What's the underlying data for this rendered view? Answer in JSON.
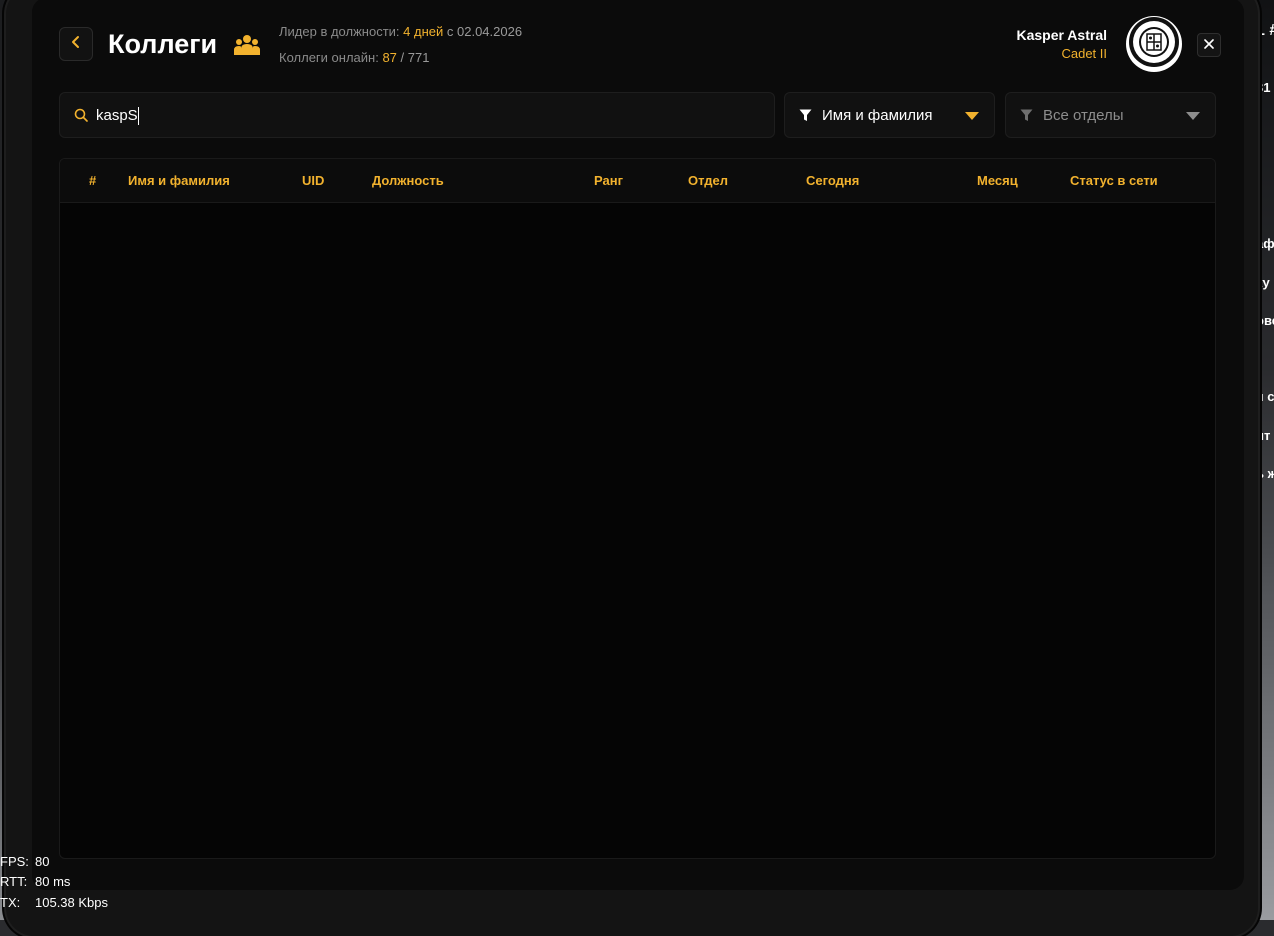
{
  "header": {
    "title": "Коллеги",
    "leader_label": "Лидер в должности:",
    "leader_days": "4 дней",
    "leader_since": "с 02.04.2026",
    "online_label": "Коллеги онлайн:",
    "online_count": "87",
    "online_total": "/ 771"
  },
  "user": {
    "name": "Kasper Astral",
    "rank": "Cadet II"
  },
  "search": {
    "value": "kaspS"
  },
  "filters": {
    "sort_by": "Имя и фамилия",
    "department": "Все отделы"
  },
  "table": {
    "columns": [
      "#",
      "Имя и фамилия",
      "UID",
      "Должность",
      "Ранг",
      "Отдел",
      "Сегодня",
      "Месяц",
      "Статус в сети"
    ],
    "rows": []
  },
  "debug_stats": {
    "fps_label": "FPS:",
    "fps_value": "80",
    "rtt_label": "RTT:",
    "rtt_value": "80 ms",
    "tx_label": "TX:",
    "tx_value": "105.38 Kbps"
  },
  "colors": {
    "accent": "#f2b22e",
    "background": "#0b0b0b",
    "panel": "#111111"
  }
}
